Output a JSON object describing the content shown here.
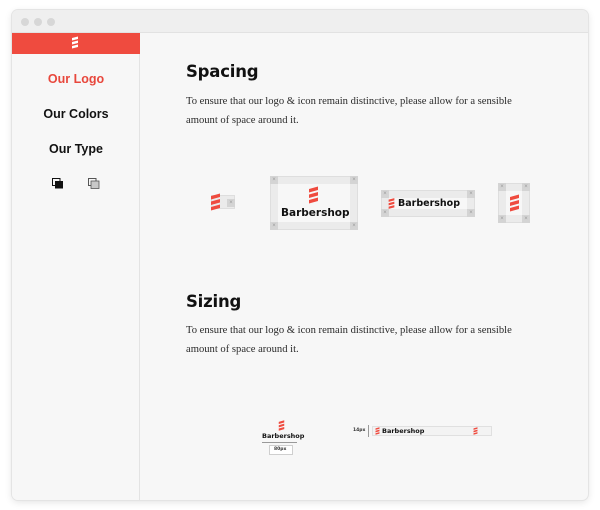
{
  "nav": {
    "items": [
      {
        "label": "Our Logo",
        "active": true
      },
      {
        "label": "Our Colors",
        "active": false
      },
      {
        "label": "Our Type",
        "active": false
      }
    ],
    "theme_toggle": [
      "dark-square-icon",
      "light-square-icon"
    ]
  },
  "sections": {
    "spacing": {
      "title": "Spacing",
      "description": "To ensure that our logo & icon remain distinctive, please allow for a sensible amount of space around it.",
      "illustration": {
        "wordmark_large": "Barbershop",
        "wordmark_horizontal": "Barbershop"
      }
    },
    "sizing": {
      "title": "Sizing",
      "description": "To ensure that our logo & icon remain distinctive, please allow for a sensible amount of space around it.",
      "illustration": {
        "wordmark_stacked": "Barbershop",
        "min_width_label": "80px",
        "wordmark_horizontal": "Barbershop",
        "min_height_label": "14px"
      }
    }
  },
  "colors": {
    "brand_red": "#ef4b3f",
    "active_nav": "#e8473c",
    "background": "#f7f7f7"
  }
}
